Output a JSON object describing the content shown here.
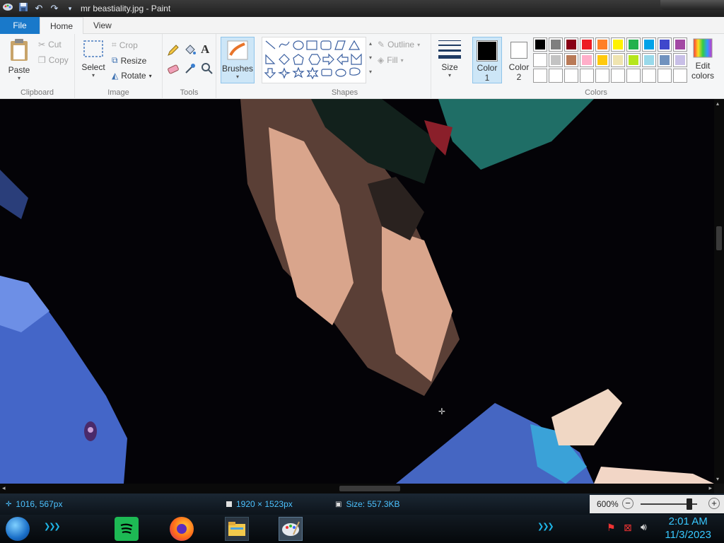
{
  "window": {
    "title": "mr beastiality.jpg - Paint"
  },
  "tabs": [
    {
      "label": "File"
    },
    {
      "label": "Home"
    },
    {
      "label": "View"
    }
  ],
  "ribbon": {
    "clipboard": {
      "group_label": "Clipboard",
      "paste": "Paste",
      "cut": "Cut",
      "copy": "Copy"
    },
    "image": {
      "group_label": "Image",
      "select": "Select",
      "crop": "Crop",
      "resize": "Resize",
      "rotate": "Rotate"
    },
    "tools": {
      "group_label": "Tools"
    },
    "brushes": {
      "label": "Brushes"
    },
    "shapes": {
      "group_label": "Shapes",
      "outline": "Outline",
      "fill": "Fill"
    },
    "size": {
      "label": "Size"
    },
    "colors": {
      "group_label": "Colors",
      "color1_label": "Color",
      "color1_number": "1",
      "color2_label": "Color",
      "color2_number": "2",
      "edit_line1": "Edit",
      "edit_line2": "colors",
      "color1": "#000000",
      "color2": "#ffffff",
      "palette_row1": [
        "#000000",
        "#7f7f7f",
        "#880015",
        "#ed1c24",
        "#ff7f27",
        "#fff200",
        "#22b14c",
        "#00a2e8",
        "#3f48cc",
        "#a349a4"
      ],
      "palette_row2": [
        "#ffffff",
        "#c3c3c3",
        "#b97a57",
        "#ffaec9",
        "#ffc90e",
        "#efe4b0",
        "#b5e61d",
        "#99d9ea",
        "#7092be",
        "#c8bfe7"
      ]
    }
  },
  "status": {
    "cursor_pos": "1016, 567px",
    "dimensions": "1920 × 1523px",
    "size": "Size: 557.3KB",
    "zoom": "600%",
    "zoom_fraction": 0.86
  },
  "taskbar": {
    "time": "2:01 AM",
    "date": "11/3/2023"
  }
}
